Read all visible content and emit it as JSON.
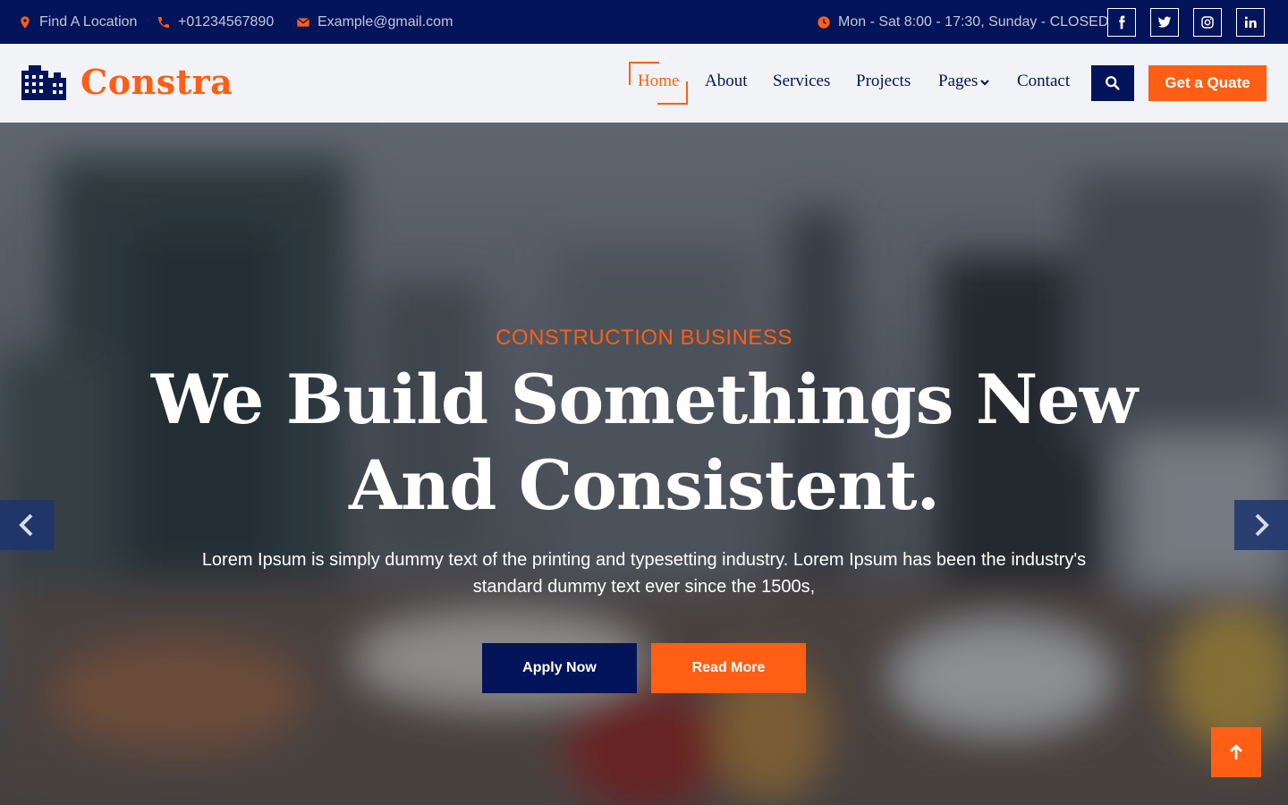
{
  "topbar": {
    "location": "Find A Location",
    "phone": "+01234567890",
    "email": "Example@gmail.com",
    "hours": "Mon - Sat 8:00 - 17:30, Sunday - CLOSED",
    "socials": [
      "facebook-icon",
      "twitter-icon",
      "instagram-icon",
      "linkedin-icon"
    ]
  },
  "brand": {
    "name": "Constra"
  },
  "nav": {
    "items": [
      "Home",
      "About",
      "Services",
      "Projects",
      "Pages",
      "Contact"
    ],
    "active": "Home",
    "quote_label": "Get a Quate"
  },
  "hero": {
    "eyebrow": "CONSTRUCTION BUSINESS",
    "title_line1": "We Build Somethings New",
    "title_line2": "And Consistent.",
    "description": "Lorem Ipsum is simply dummy text of the printing and typesetting industry. Lorem Ipsum has been the industry's standard dummy text ever since the 1500s,",
    "primary_button": "Apply Now",
    "secondary_button": "Read More"
  },
  "colors": {
    "navy": "#03145a",
    "orange": "#ff5e15",
    "light": "#f2f3f6"
  }
}
